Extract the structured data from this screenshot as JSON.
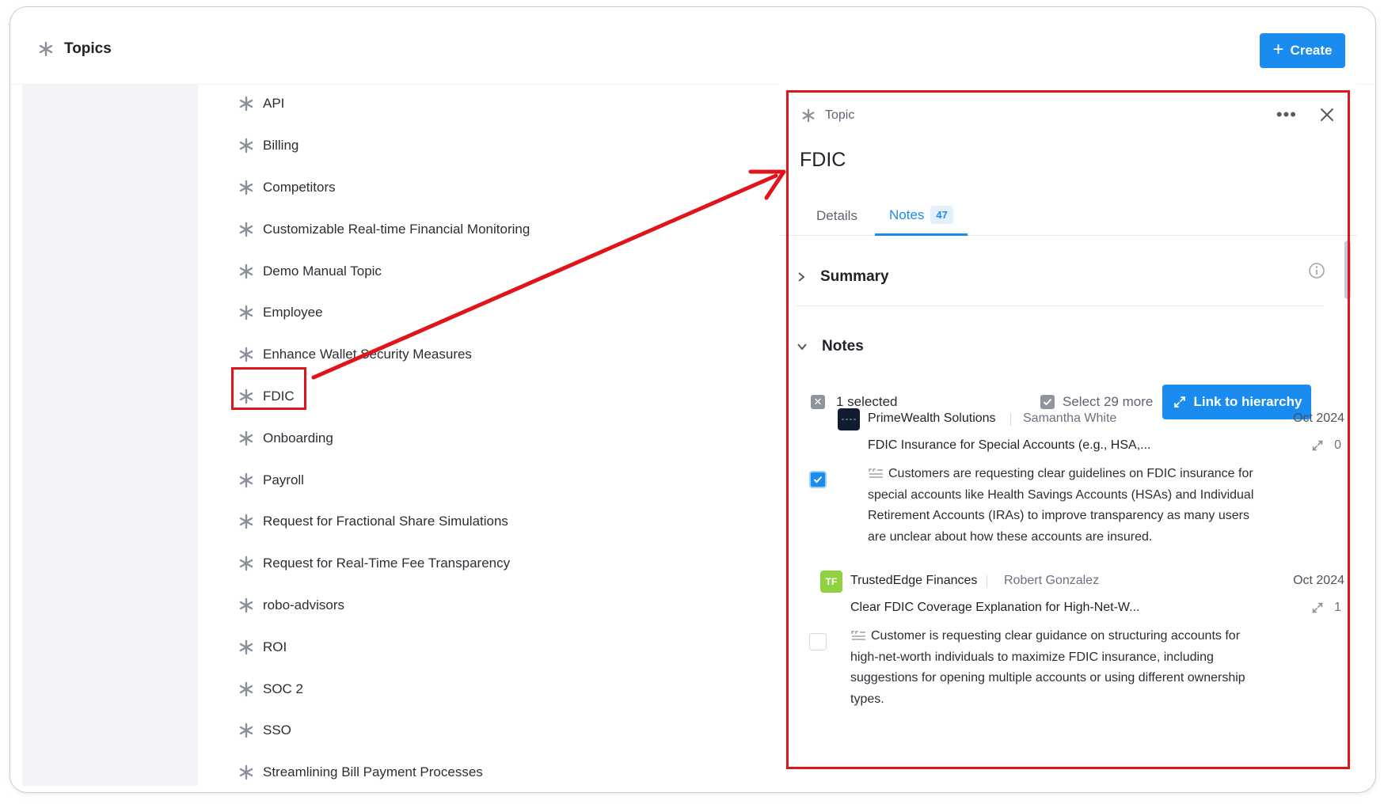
{
  "header": {
    "title": "Topics",
    "create_label": "Create"
  },
  "topics": [
    "API",
    "Billing",
    "Competitors",
    "Customizable Real-time Financial Monitoring",
    "Demo Manual Topic",
    "Employee",
    "Enhance Wallet Security Measures",
    "FDIC",
    "Onboarding",
    "Payroll",
    "Request for Fractional Share Simulations",
    "Request for Real-Time Fee Transparency",
    "robo-advisors",
    "ROI",
    "SOC 2",
    "SSO",
    "Streamlining Bill Payment Processes"
  ],
  "selected_topic": "FDIC",
  "panel": {
    "kind_label": "Topic",
    "title": "FDIC",
    "tabs": {
      "details": "Details",
      "notes": "Notes",
      "notes_count": "47"
    },
    "summary_label": "Summary",
    "notes_label": "Notes",
    "selection": {
      "selected_text": "1 selected",
      "select_more": "Select 29 more",
      "link_button": "Link to hierarchy"
    },
    "notes": [
      {
        "company": "PrimeWealth Solutions",
        "author": "Samantha White",
        "date": "Oct 2024",
        "title": "FDIC Insurance for Special Accounts (e.g., HSA,...",
        "links": "0",
        "body": "Customers are requesting clear guidelines on FDIC insurance for special accounts like Health Savings Accounts (HSAs) and Individual Retirement Accounts (IRAs) to improve transparency as many users are unclear about how these accounts are insured.",
        "checked": true
      },
      {
        "company": "TrustedEdge Finances",
        "logo_text": "TF",
        "author": "Robert Gonzalez",
        "date": "Oct 2024",
        "title": "Clear FDIC Coverage Explanation for High-Net-W...",
        "links": "1",
        "body": "Customer is requesting clear guidance on structuring accounts for high-net-worth individuals to maximize FDIC insurance, including suggestions for opening multiple accounts or using different ownership types.",
        "checked": false
      }
    ]
  },
  "colors": {
    "accent": "#1a8cf0",
    "annotation": "#e0141b",
    "tf_logo": "#8fd13f"
  }
}
